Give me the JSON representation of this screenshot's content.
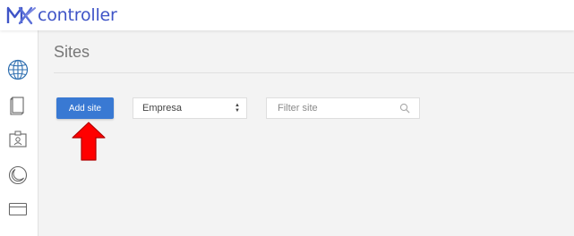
{
  "app": {
    "logo_text": "controller"
  },
  "sidebar": {
    "items": [
      {
        "icon": "globe-icon"
      },
      {
        "icon": "book-icon"
      },
      {
        "icon": "id-badge-icon"
      },
      {
        "icon": "moon-icon"
      },
      {
        "icon": "card-icon"
      }
    ]
  },
  "page": {
    "title": "Sites"
  },
  "toolbar": {
    "add_site_label": "Add site",
    "company_select": {
      "selected": "Empresa"
    },
    "filter": {
      "placeholder": "Filter site"
    }
  },
  "colors": {
    "accent": "#3979d3",
    "logo": "#3f54c7",
    "arrow": "#ff0000"
  }
}
